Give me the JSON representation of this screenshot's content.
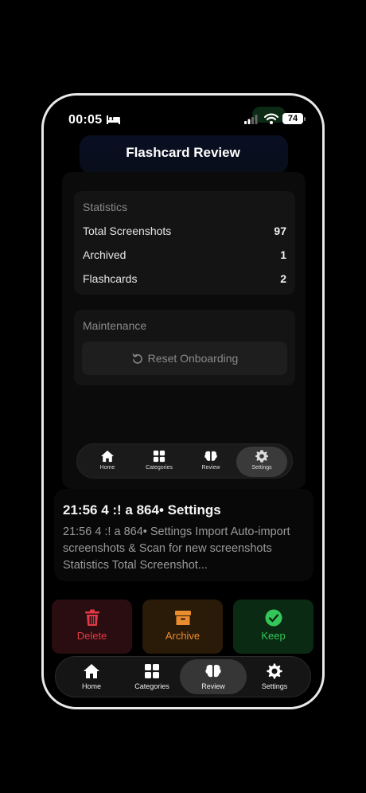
{
  "status_bar": {
    "time": "00:05",
    "battery": "74"
  },
  "header": {
    "title": "Flashcard Review"
  },
  "preview": {
    "statistics": {
      "title": "Statistics",
      "rows": [
        {
          "label": "Total Screenshots",
          "value": "97"
        },
        {
          "label": "Archived",
          "value": "1"
        },
        {
          "label": "Flashcards",
          "value": "2"
        }
      ]
    },
    "maintenance": {
      "title": "Maintenance",
      "reset_label": "Reset Onboarding"
    },
    "tabs": [
      {
        "label": "Home",
        "icon": "home-icon"
      },
      {
        "label": "Categories",
        "icon": "grid-icon"
      },
      {
        "label": "Review",
        "icon": "brain-icon"
      },
      {
        "label": "Settings",
        "icon": "gear-icon",
        "active": true
      }
    ]
  },
  "caption": {
    "title": "21:56 4 :! a 864• Settings",
    "body": "21:56 4 :! a 864• Settings Import Auto-import screenshots & Scan for new screenshots Statistics Total Screenshot..."
  },
  "actions": {
    "delete_label": "Delete",
    "archive_label": "Archive",
    "keep_label": "Keep",
    "colors": {
      "delete": "#e23a45",
      "archive": "#e98d2f",
      "keep": "#35c65a"
    }
  },
  "tabbar": {
    "tabs": [
      {
        "label": "Home",
        "icon": "home-icon"
      },
      {
        "label": "Categories",
        "icon": "grid-icon"
      },
      {
        "label": "Review",
        "icon": "brain-icon",
        "active": true
      },
      {
        "label": "Settings",
        "icon": "gear-icon"
      }
    ]
  }
}
